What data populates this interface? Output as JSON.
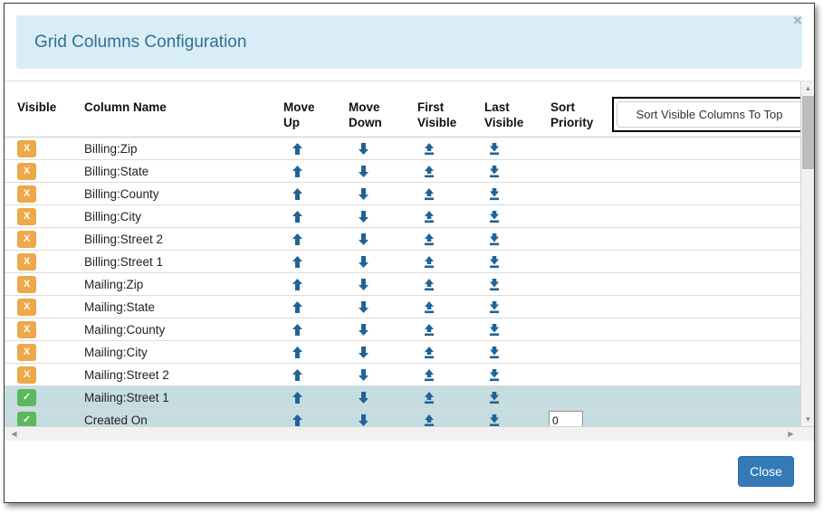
{
  "dialog": {
    "title": "Grid Columns Configuration",
    "close_x": "×",
    "close_button_label": "Close"
  },
  "toolbar": {
    "sort_visible_to_top_label": "Sort Visible Columns To Top"
  },
  "grid": {
    "headers": [
      {
        "line1": "Visible",
        "line2": ""
      },
      {
        "line1": "Column Name",
        "line2": ""
      },
      {
        "line1": "Move",
        "line2": "Up"
      },
      {
        "line1": "Move",
        "line2": "Down"
      },
      {
        "line1": "First",
        "line2": "Visible"
      },
      {
        "line1": "Last",
        "line2": "Visible"
      },
      {
        "line1": "Sort",
        "line2": "Priority"
      }
    ],
    "badge_on_glyph": "✓",
    "badge_off_glyph": "X",
    "badge_on_color": "#5cb85c",
    "badge_off_color": "#eda84a",
    "selected_row_color": "#c5dde1",
    "icon_color": "#1f6397",
    "rows": [
      {
        "visible": false,
        "name": "Billing:Zip",
        "sort_priority": null,
        "selected": false
      },
      {
        "visible": false,
        "name": "Billing:State",
        "sort_priority": null,
        "selected": false
      },
      {
        "visible": false,
        "name": "Billing:County",
        "sort_priority": null,
        "selected": false
      },
      {
        "visible": false,
        "name": "Billing:City",
        "sort_priority": null,
        "selected": false
      },
      {
        "visible": false,
        "name": "Billing:Street 2",
        "sort_priority": null,
        "selected": false
      },
      {
        "visible": false,
        "name": "Billing:Street 1",
        "sort_priority": null,
        "selected": false
      },
      {
        "visible": false,
        "name": "Mailing:Zip",
        "sort_priority": null,
        "selected": false
      },
      {
        "visible": false,
        "name": "Mailing:State",
        "sort_priority": null,
        "selected": false
      },
      {
        "visible": false,
        "name": "Mailing:County",
        "sort_priority": null,
        "selected": false
      },
      {
        "visible": false,
        "name": "Mailing:City",
        "sort_priority": null,
        "selected": false
      },
      {
        "visible": false,
        "name": "Mailing:Street 2",
        "sort_priority": null,
        "selected": false
      },
      {
        "visible": true,
        "name": "Mailing:Street 1",
        "sort_priority": null,
        "selected": true
      },
      {
        "visible": true,
        "name": "Created On",
        "sort_priority": "0",
        "selected": true
      }
    ]
  },
  "scrollbars": {
    "vertical_up_glyph": "▲",
    "vertical_down_glyph": "▼",
    "horizontal_left_glyph": "◀",
    "horizontal_right_glyph": "▶"
  }
}
